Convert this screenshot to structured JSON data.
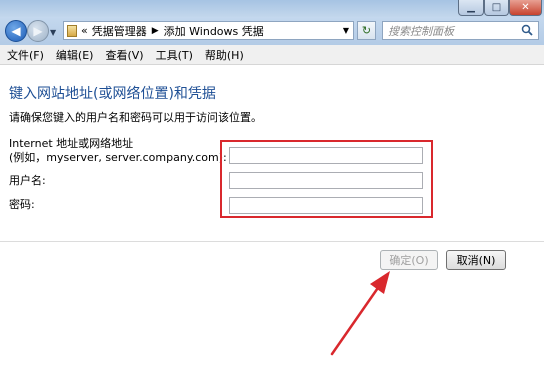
{
  "window": {
    "controls": {
      "min": "▁",
      "max": "□",
      "close": "✕"
    }
  },
  "nav": {
    "back_icon": "arrow-left-icon",
    "forward_icon": "arrow-right-icon",
    "address": {
      "overflow": "«",
      "crumb1": "凭据管理器",
      "separator": "▶",
      "crumb2": "添加 Windows 凭据"
    },
    "search_placeholder": "搜索控制面板"
  },
  "menubar": {
    "file": "文件(F)",
    "edit": "编辑(E)",
    "view": "查看(V)",
    "tools": "工具(T)",
    "help": "帮助(H)"
  },
  "form": {
    "heading": "键入网站地址(或网络位置)和凭据",
    "subtext": "请确保您键入的用户名和密码可以用于访问该位置。",
    "address_label_line1": "Internet 地址或网络地址",
    "address_label_line2": "(例如，myserver, server.company.com):",
    "username_label": "用户名:",
    "password_label": "密码:",
    "address_value": "",
    "username_value": "",
    "password_value": ""
  },
  "buttons": {
    "ok": "确定(O)",
    "cancel": "取消(N)"
  },
  "annotation": {
    "highlight_color": "#d9282d",
    "arrow_color": "#d9282d"
  }
}
